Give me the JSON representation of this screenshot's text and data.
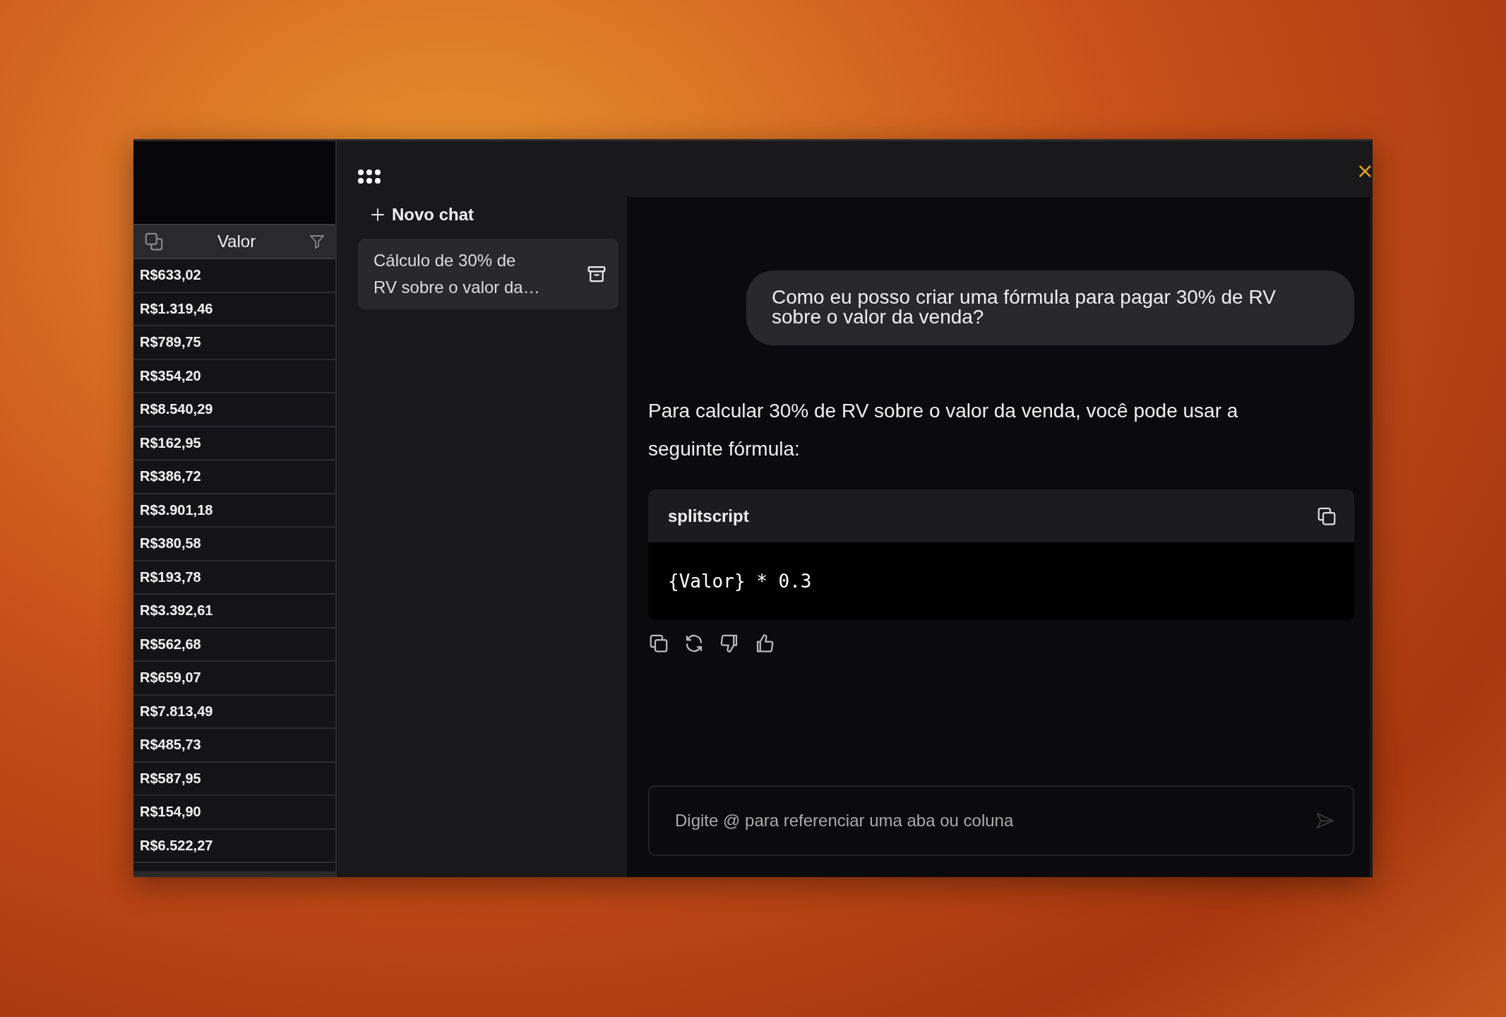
{
  "sheet": {
    "column_header": "Valor",
    "cells": [
      "R$633,02",
      "R$1.319,46",
      "R$789,75",
      "R$354,20",
      "R$8.540,29",
      "R$162,95",
      "R$386,72",
      "R$3.901,18",
      "R$380,58",
      "R$193,78",
      "R$3.392,61",
      "R$562,68",
      "R$659,07",
      "R$7.813,49",
      "R$485,73",
      "R$587,95",
      "R$154,90",
      "R$6.522,27"
    ]
  },
  "sidebar": {
    "new_chat": "Novo chat",
    "chats": [
      {
        "title": "Cálculo de 30% de RV sobre o valor da…",
        "selected": true
      }
    ]
  },
  "chat": {
    "close": "×",
    "messages": [
      {
        "kind": "user",
        "text": "Como eu posso criar uma fórmula para pagar 30% de RV sobre o valor da venda?"
      },
      {
        "kind": "assistant",
        "text": "Para calcular 30% de RV sobre o valor da venda, você pode usar a seguinte fórmula:",
        "code": {
          "language": "splitscript",
          "code": "{Valor} * 0.3"
        }
      }
    ],
    "input": {
      "placeholder": "Digite @ para referenciar uma aba ou coluna"
    }
  }
}
